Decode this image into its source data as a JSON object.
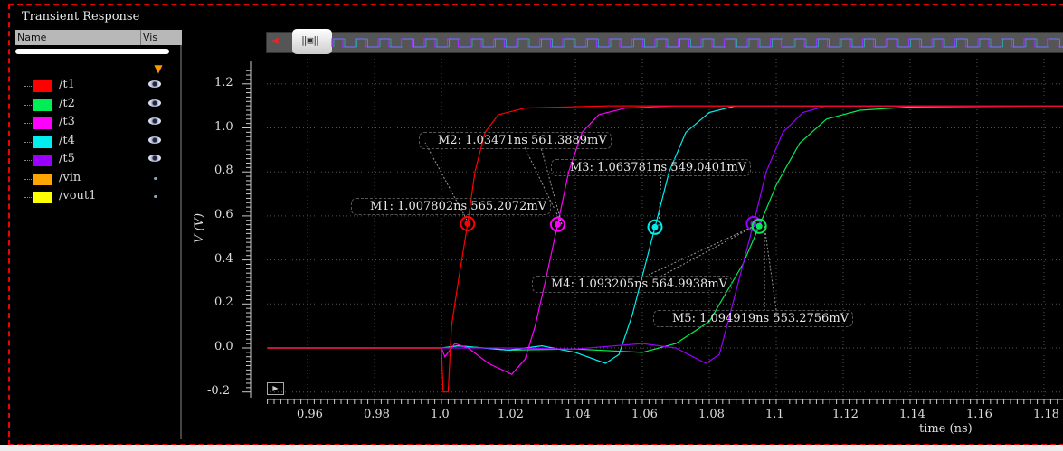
{
  "panel": {
    "title": "Transient Response",
    "col_name": "Name",
    "col_vis": "Vis",
    "filter_icon": "filter-icon"
  },
  "signals": [
    {
      "name": "/t1",
      "color": "#ff0000",
      "visible": true
    },
    {
      "name": "/t2",
      "color": "#00ee55",
      "visible": true
    },
    {
      "name": "/t3",
      "color": "#ff00ff",
      "visible": true
    },
    {
      "name": "/t4",
      "color": "#00eeee",
      "visible": true
    },
    {
      "name": "/t5",
      "color": "#9900ff",
      "visible": true
    },
    {
      "name": "/vin",
      "color": "#ffa500",
      "visible": false
    },
    {
      "name": "/vout1",
      "color": "#ffff00",
      "visible": false
    }
  ],
  "markers": [
    {
      "id": "M1",
      "label": "M1: 1.007802ns 565.2072mV",
      "t": 1.007802,
      "v": 0.5652072,
      "color": "#ff0000"
    },
    {
      "id": "M2",
      "label": "M2: 1.03471ns 561.3889mV",
      "t": 1.03471,
      "v": 0.5613889,
      "color": "#ff00ff"
    },
    {
      "id": "M3",
      "label": "M3: 1.063781ns 549.0401mV",
      "t": 1.063781,
      "v": 0.5490401,
      "color": "#00eeee"
    },
    {
      "id": "M4",
      "label": "M4: 1.093205ns 564.9938mV",
      "t": 1.093205,
      "v": 0.5649938,
      "color": "#9900ff"
    },
    {
      "id": "M5",
      "label": "M5: 1.094919ns 553.2756mV",
      "t": 1.094919,
      "v": 0.5532756,
      "color": "#00ee55"
    }
  ],
  "chart_data": {
    "type": "line",
    "xlabel": "time (ns)",
    "ylabel": "V (V)",
    "xlim": [
      0.948,
      1.186
    ],
    "ylim": [
      -0.21,
      1.28
    ],
    "xticks": [
      "0.96",
      "0.98",
      "1.0",
      "1.02",
      "1.04",
      "1.06",
      "1.08",
      "1.1",
      "1.12",
      "1.14",
      "1.16",
      "1.18"
    ],
    "xtick_values": [
      0.96,
      0.98,
      1.0,
      1.02,
      1.04,
      1.06,
      1.08,
      1.1,
      1.12,
      1.14,
      1.16,
      1.18
    ],
    "yticks": [
      "1.2",
      "1.0",
      "0.8",
      "0.6",
      "0.4",
      "0.2",
      "0.0",
      "-0.2"
    ],
    "ytick_values": [
      1.2,
      1.0,
      0.8,
      0.6,
      0.4,
      0.2,
      0.0,
      -0.2
    ],
    "grid": true,
    "series": [
      {
        "name": "/t2",
        "color": "#00ee55",
        "points": [
          [
            0.948,
            0
          ],
          [
            1.0,
            0
          ],
          [
            1.005,
            0.01
          ],
          [
            1.02,
            -0.01
          ],
          [
            1.04,
            -0.005
          ],
          [
            1.06,
            -0.02
          ],
          [
            1.07,
            0.02
          ],
          [
            1.08,
            0.12
          ],
          [
            1.09,
            0.38
          ],
          [
            1.094919,
            0.553
          ],
          [
            1.1,
            0.74
          ],
          [
            1.107,
            0.93
          ],
          [
            1.115,
            1.04
          ],
          [
            1.125,
            1.08
          ],
          [
            1.14,
            1.095
          ],
          [
            1.186,
            1.1
          ]
        ]
      },
      {
        "name": "/t4",
        "color": "#00eeee",
        "points": [
          [
            0.948,
            0
          ],
          [
            1.0,
            0
          ],
          [
            1.005,
            0.01
          ],
          [
            1.02,
            -0.01
          ],
          [
            1.03,
            0.01
          ],
          [
            1.04,
            -0.02
          ],
          [
            1.049,
            -0.07
          ],
          [
            1.053,
            -0.03
          ],
          [
            1.057,
            0.15
          ],
          [
            1.063781,
            0.549
          ],
          [
            1.068,
            0.8
          ],
          [
            1.073,
            0.98
          ],
          [
            1.08,
            1.07
          ],
          [
            1.088,
            1.1
          ],
          [
            1.186,
            1.1
          ]
        ]
      },
      {
        "name": "/t5",
        "color": "#9900ff",
        "points": [
          [
            0.948,
            0
          ],
          [
            1.0,
            0
          ],
          [
            1.02,
            0.0
          ],
          [
            1.04,
            -0.005
          ],
          [
            1.06,
            0.02
          ],
          [
            1.07,
            0.0
          ],
          [
            1.079,
            -0.07
          ],
          [
            1.083,
            -0.03
          ],
          [
            1.087,
            0.2
          ],
          [
            1.093205,
            0.565
          ],
          [
            1.097,
            0.8
          ],
          [
            1.102,
            0.98
          ],
          [
            1.108,
            1.07
          ],
          [
            1.115,
            1.1
          ],
          [
            1.186,
            1.1
          ]
        ]
      },
      {
        "name": "/t3",
        "color": "#ff00ff",
        "points": [
          [
            0.948,
            0
          ],
          [
            1.0,
            0
          ],
          [
            1.001,
            -0.04
          ],
          [
            1.004,
            0.02
          ],
          [
            1.008,
            0.0
          ],
          [
            1.014,
            -0.07
          ],
          [
            1.021,
            -0.12
          ],
          [
            1.025,
            -0.05
          ],
          [
            1.028,
            0.1
          ],
          [
            1.031,
            0.3
          ],
          [
            1.03471,
            0.561
          ],
          [
            1.038,
            0.8
          ],
          [
            1.042,
            0.98
          ],
          [
            1.047,
            1.06
          ],
          [
            1.055,
            1.09
          ],
          [
            1.07,
            1.1
          ],
          [
            1.186,
            1.1
          ]
        ]
      },
      {
        "name": "/t1",
        "color": "#ff0000",
        "points": [
          [
            0.948,
            0
          ],
          [
            1.0,
            0
          ],
          [
            1.0005,
            -0.2
          ],
          [
            1.002,
            -0.2
          ],
          [
            1.003,
            0.1
          ],
          [
            1.005,
            0.3
          ],
          [
            1.007802,
            0.565
          ],
          [
            1.01,
            0.8
          ],
          [
            1.013,
            0.98
          ],
          [
            1.017,
            1.06
          ],
          [
            1.025,
            1.09
          ],
          [
            1.05,
            1.1
          ],
          [
            1.186,
            1.1
          ]
        ]
      }
    ]
  }
}
